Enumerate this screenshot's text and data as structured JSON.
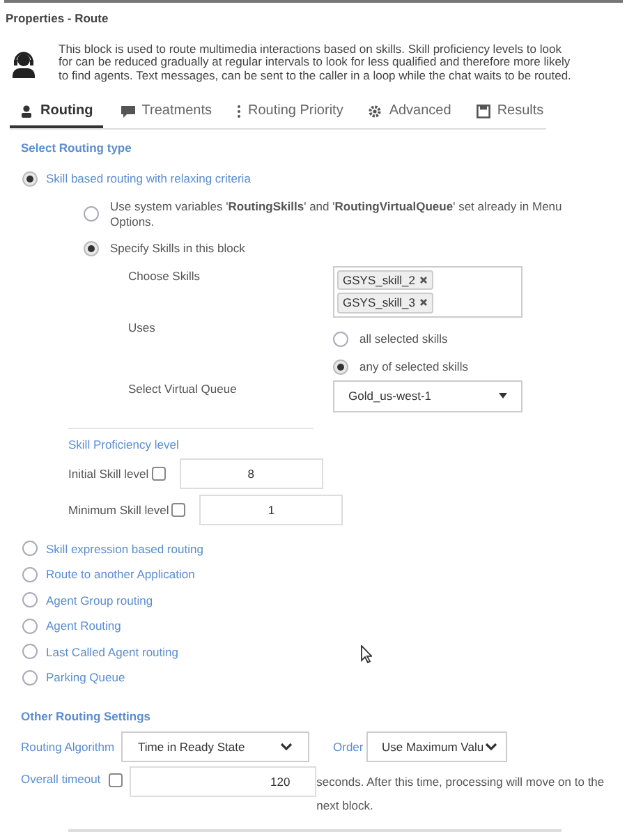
{
  "panel": {
    "title": "Properties - Route",
    "description": "This block is used to route multimedia interactions based on skills. Skill proficiency levels to look for can be reduced gradually at regular intervals to look for less qualified and therefore more likely to find agents. Text messages, can be sent to the caller in a loop while the chat waits to be routed."
  },
  "tabs": [
    {
      "label": "Routing",
      "selected": true
    },
    {
      "label": "Treatments",
      "selected": false
    },
    {
      "label": "Routing Priority",
      "selected": false
    },
    {
      "label": "Advanced",
      "selected": false
    },
    {
      "label": "Results",
      "selected": false
    }
  ],
  "routing_type": {
    "heading": "Select Routing type",
    "options": [
      {
        "label": "Skill based routing with relaxing criteria",
        "selected": true,
        "kind": "skills",
        "sub_options": [
          {
            "label": "Use system variables '**RoutingSkills**' and '**RoutingVirtualQueue**' set already in Menu Options.",
            "selected": false
          },
          {
            "label": "Specify Skills in this block",
            "selected": true
          }
        ],
        "choose_skills": {
          "label": "Choose Skills",
          "tags": [
            "GSYS_skill_2",
            "GSYS_skill_3"
          ]
        },
        "uses": {
          "label": "Uses",
          "choices": [
            {
              "label": "all selected skills",
              "selected": false
            },
            {
              "label": "any of selected skills",
              "selected": true
            }
          ]
        },
        "virtual_queue": {
          "label": "Select Virtual Queue",
          "value": "Gold_us-west-1"
        },
        "proficiency": {
          "heading": "Skill Proficiency level",
          "fields": [
            {
              "label": "Initial Skill level",
              "checked": false,
              "value": "8"
            },
            {
              "label": "Minimum Skill level",
              "checked": false,
              "value": "1"
            }
          ]
        }
      },
      {
        "label": "Skill expression based routing",
        "selected": false,
        "kind": "simple"
      },
      {
        "label": "Route to another Application",
        "selected": false,
        "kind": "simple"
      },
      {
        "label": "Agent Group routing",
        "selected": false,
        "kind": "simple"
      },
      {
        "label": "Agent Routing",
        "selected": false,
        "kind": "simple"
      },
      {
        "label": "Last Called Agent routing",
        "selected": false,
        "kind": "simple"
      },
      {
        "label": "Parking Queue",
        "selected": false,
        "kind": "simple"
      }
    ]
  },
  "other_settings": {
    "heading": "Other Routing Settings",
    "algorithm": {
      "label": "Routing Algorithm",
      "value": "Time in Ready State"
    },
    "order": {
      "label": "Order",
      "value": "Use Maximum Valu"
    },
    "timeout": {
      "label": "Overall timeout",
      "checked": false,
      "value": "120",
      "suffix": "seconds. After this time, processing will move on to the next block."
    }
  }
}
